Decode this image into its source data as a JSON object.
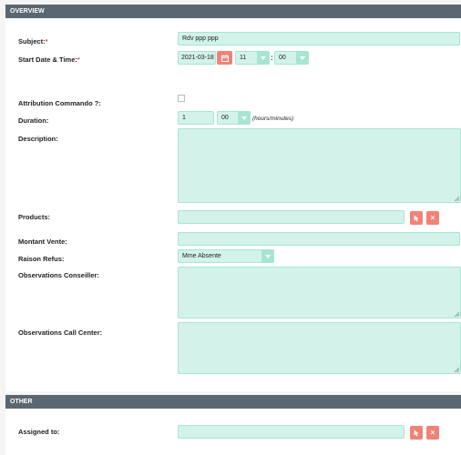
{
  "sections": {
    "overview": "OVERVIEW",
    "other": "OTHER"
  },
  "fields": {
    "subject": {
      "label": "Subject:",
      "required_mark": "*",
      "value": "Rdv ppp ppp"
    },
    "start": {
      "label": "Start Date & Time:",
      "required_mark": "*",
      "date": "2021-03-18",
      "hour": "11",
      "separator": ":",
      "minute": "00"
    },
    "attribution": {
      "label": "Attribution Commando ?:",
      "checked": false
    },
    "duration": {
      "label": "Duration:",
      "hours": "1",
      "minutes": "00",
      "units": "(hours/minutes)"
    },
    "description": {
      "label": "Description:",
      "value": ""
    },
    "products": {
      "label": "Products:",
      "value": ""
    },
    "montant_vente": {
      "label": "Montant Vente:",
      "value": ""
    },
    "raison_refus": {
      "label": "Raison Refus:",
      "value": "Mme Absente"
    },
    "obs_conseiller": {
      "label": "Observations Conseiller:",
      "value": ""
    },
    "obs_call_center": {
      "label": "Observations Call Center:",
      "value": ""
    },
    "assigned_to": {
      "label": "Assigned to:",
      "value": ""
    }
  },
  "icons": {
    "calendar": "calendar-icon",
    "select": "select-arrow-icon",
    "clear": "×"
  },
  "colors": {
    "header_bg": "#5b6770",
    "field_bg": "#d3f3ea",
    "field_border": "#a7e5d3",
    "button_bg": "#f08377",
    "required": "#e04c4c"
  }
}
